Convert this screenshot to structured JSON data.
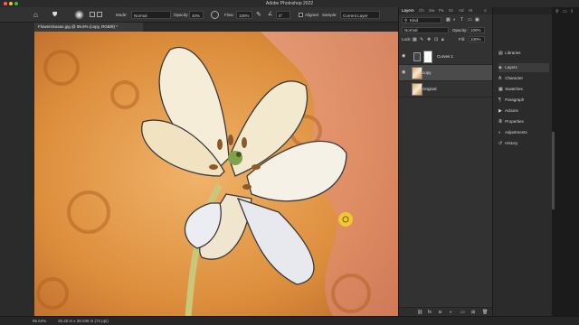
{
  "app": {
    "title": "Adobe Photoshop 2022"
  },
  "traffic_lights": [
    "#ff5f57",
    "#febc2e",
    "#28c840"
  ],
  "options_bar": {
    "mode_label": "Mode:",
    "mode_value": "Normal",
    "opacity_label": "Opacity:",
    "opacity_value": "40%",
    "flow_label": "Flow:",
    "flow_value": "100%",
    "angle_value": "0°",
    "aligned_label": "Aligned",
    "sample_label": "Sample:",
    "sample_value": "Current Layer"
  },
  "document": {
    "tab_label": "FlowersSusan.jpg @ 95.6% (copy, RGB/8) *"
  },
  "status_bar": {
    "zoom": "95.64%",
    "doc_info": "26.20 in x 38.038 in (72 ppi)"
  },
  "layers_panel": {
    "tabs": [
      "Layers",
      "Ch",
      "Sw",
      "Pa",
      "Gr",
      "Ad",
      "Hi"
    ],
    "kind_label": "Kind",
    "blend_mode": "Normal",
    "opacity_label": "Opacity:",
    "opacity_value": "100%",
    "lock_label": "Lock:",
    "fill_label": "Fill:",
    "fill_value": "100%",
    "layers": [
      {
        "name": "Curves 1"
      },
      {
        "name": "copy"
      },
      {
        "name": "Original"
      }
    ]
  },
  "dock": {
    "items": [
      {
        "label": "Libraries",
        "icon": "libraries-icon"
      },
      {
        "label": "Layers",
        "icon": "layers-icon"
      },
      {
        "label": "Character",
        "icon": "character-icon"
      },
      {
        "label": "Swatches",
        "icon": "swatches-icon"
      },
      {
        "label": "Paragraph",
        "icon": "paragraph-icon"
      },
      {
        "label": "Actions",
        "icon": "actions-icon"
      },
      {
        "label": "Properties",
        "icon": "properties-icon"
      },
      {
        "label": "Adjustments",
        "icon": "adjustments-icon"
      },
      {
        "label": "History",
        "icon": "history-icon"
      }
    ]
  }
}
